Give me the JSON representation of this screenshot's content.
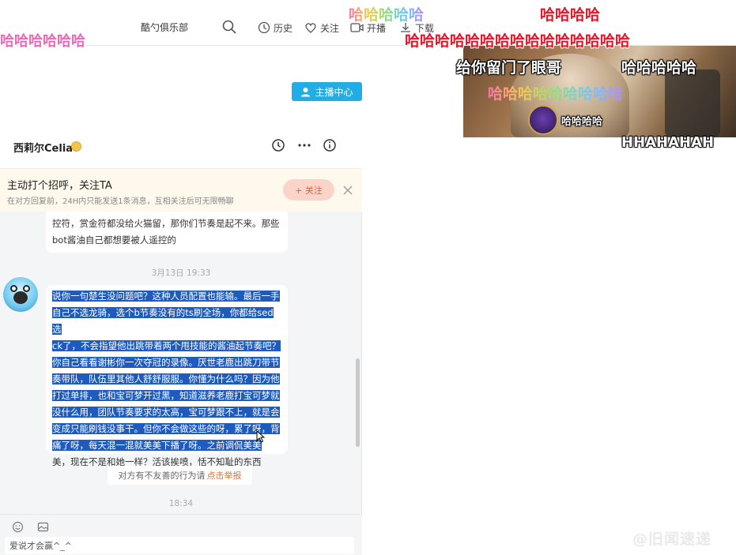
{
  "topbar": {
    "search_text": "酷勺俱乐部",
    "nav": [
      {
        "label": "历史",
        "icon": "clock-icon"
      },
      {
        "label": "关注",
        "icon": "heart-icon"
      },
      {
        "label": "开播",
        "icon": "camera-icon"
      },
      {
        "label": "下载",
        "icon": "download-icon"
      }
    ]
  },
  "danmaku": {
    "d1": "哈哈哈哈哈哈",
    "d2": "哈哈哈哈哈",
    "d3": "哈哈哈哈",
    "d4": "哈哈哈哈哈哈哈哈哈哈哈哈哈哈哈",
    "d5": "给你留门了眼哥",
    "d6": "哈哈哈哈哈",
    "d7": "哈哈哈哈哈哈哈哈哈",
    "d8": "哈哈哈哈",
    "d9": "HHAHAHAH",
    "d10": "哈哈哈哈哈"
  },
  "video": {
    "badge_label": "哈哈哈哈"
  },
  "live_center": {
    "label": "主播中心"
  },
  "chat": {
    "contact_name": "西莉尔Celia",
    "follow_bar": {
      "title": "主动打个招呼，关注TA",
      "subtitle": "在对方回复前，24H内只能发送1条消息，互相关注后可无限畅聊",
      "button": "+ 关注"
    },
    "bubble1": {
      "line1": "控符，赏金符都没给火猫留，那你们节奏是起不来。那些",
      "line2": "bot酱油自己都想要被人遥控的"
    },
    "time1": "3月13日 19:33",
    "bubble2": {
      "lines": [
        "说你一句楚生没问题吧？这种人员配置也能输。最后一手",
        "自己不选龙骑，选个b节奏没有的ts刷全场，你都给sed选",
        "ck了，不会指望他出跳带着两个甩技能的酱油起节奏吧？",
        "你自己看看谢彬你一次夺冠的录像。厌世老鹿出跳刀带节",
        "奏带队，队伍里其他人舒舒服服。你懂为什么吗？因为他",
        "打过单排，也和宝可梦开过黑，知道滋养老鹿打宝可梦就",
        "没什么用，团队节奏要求的太高，宝可梦跟不上，就是会",
        "变成只能刷钱没事干。但你不会做这些的呀，累了呀，背",
        "痛了呀，每天混一混就美美下播了呀。之前调侃美美"
      ],
      "last_line": "美，现在不是和她一样？活该挨喷，恬不知耻的东西"
    },
    "report": {
      "text": "对方有不友善的行为请",
      "link": "点击举报"
    },
    "time2": "18:34",
    "input_placeholder": "爱说才会赢^_^"
  },
  "watermark": "@旧闻速递"
}
